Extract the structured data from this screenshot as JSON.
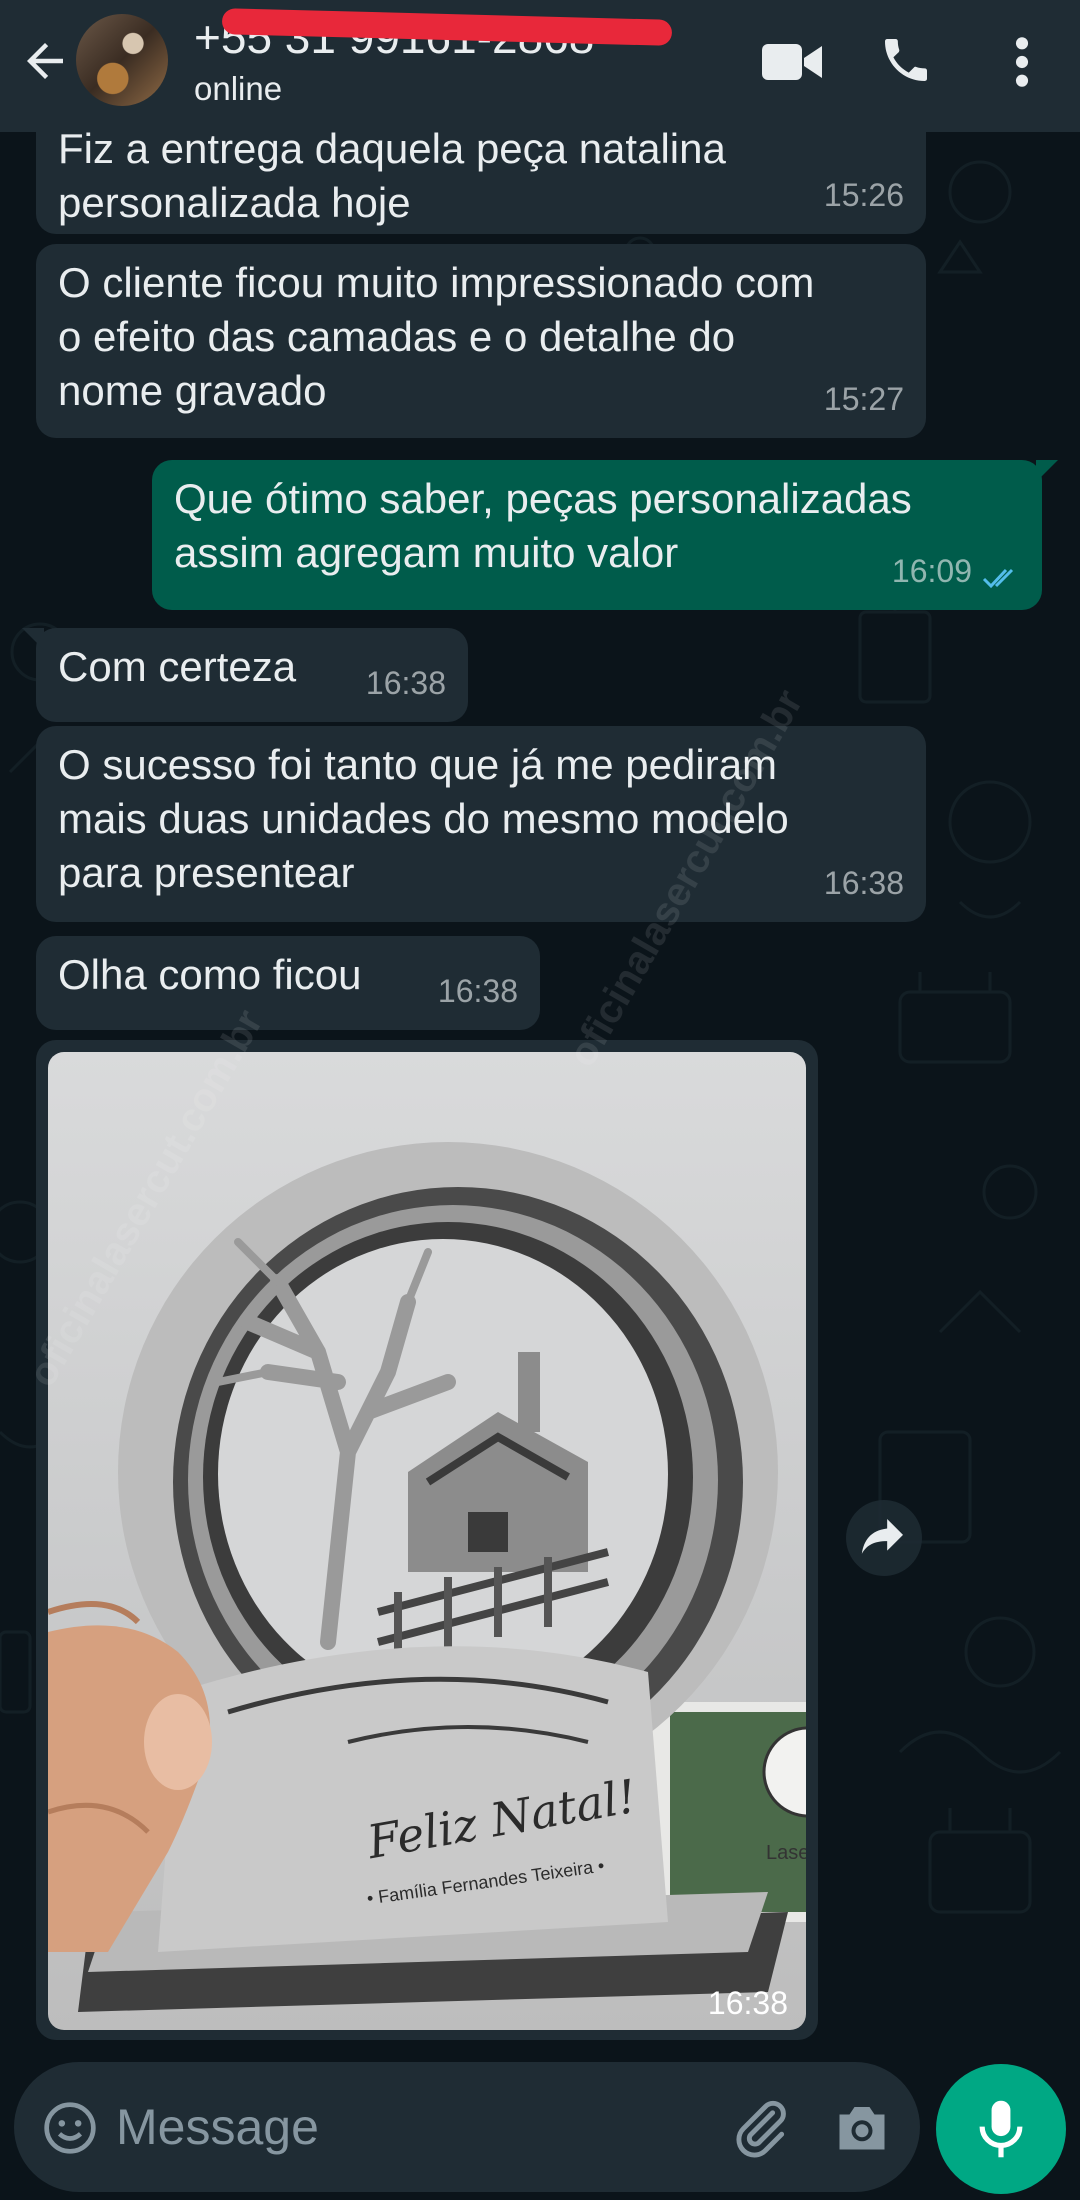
{
  "header": {
    "contact_name": "+55 31 99161-2868",
    "status": "online",
    "back_icon": "arrow-left-icon",
    "video_icon": "video-call-icon",
    "call_icon": "phone-icon",
    "menu_icon": "more-vertical-icon"
  },
  "messages": [
    {
      "direction": "in",
      "text_lines": [
        "Fiz a entrega daquela peça natalina",
        "personalizada hoje"
      ],
      "time": "15:26"
    },
    {
      "direction": "in",
      "text_lines": [
        "O cliente ficou muito impressionado com",
        "o efeito das camadas e o detalhe do",
        "nome gravado"
      ],
      "time": "15:27"
    },
    {
      "direction": "out",
      "text_lines": [
        "Que ótimo saber, peças personalizadas",
        "assim agregam muito valor"
      ],
      "time": "16:09",
      "status": "read"
    },
    {
      "direction": "in",
      "text_lines": [
        "Com certeza"
      ],
      "time": "16:38"
    },
    {
      "direction": "in",
      "text_lines": [
        "O sucesso foi tanto que já me pediram",
        "mais duas unidades do mesmo modelo",
        "para presentear"
      ],
      "time": "16:38"
    },
    {
      "direction": "in",
      "text_lines": [
        "Olha como ficou"
      ],
      "time": "16:38"
    }
  ],
  "photo_message": {
    "time": "16:38",
    "engraving_title": "Feliz Natal!",
    "engraving_subtitle": "• Família Fernandes Teixeira •",
    "card_text": "Laser"
  },
  "watermark": "oficinalasercut.com.br",
  "input": {
    "placeholder": "Message",
    "emoji_icon": "emoji-icon",
    "attach_icon": "paperclip-icon",
    "camera_icon": "camera-icon",
    "mic_icon": "microphone-icon"
  },
  "colors": {
    "header_bg": "#1f2c34",
    "chat_bg": "#0b141a",
    "incoming_bubble": "#1f2c34",
    "outgoing_bubble": "#005c4b",
    "accent": "#00a884",
    "read_ticks": "#53bdeb"
  }
}
